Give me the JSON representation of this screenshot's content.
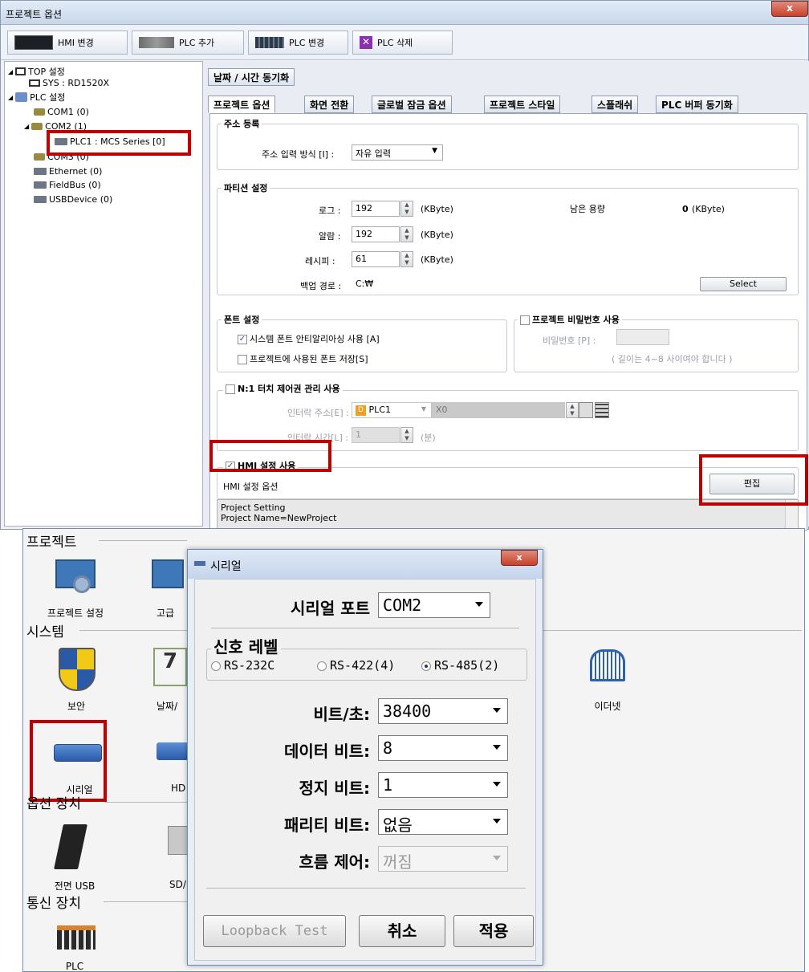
{
  "window": {
    "title": "프로젝트 옵션",
    "close": "x"
  },
  "toolbar": {
    "hmi_change": "HMI 변경",
    "plc_add": "PLC 추가",
    "plc_change": "PLC 변경",
    "plc_delete": "PLC 삭제"
  },
  "tree": {
    "top": "TOP 설정",
    "sys": "SYS : RD1520X",
    "plc": "PLC 설정",
    "com1": "COM1 (0)",
    "com2": "COM2 (1)",
    "plc1": "PLC1 : MCS Series [0]",
    "com3": "COM3 (0)",
    "ethernet": "Ethernet (0)",
    "fieldbus": "FieldBus (0)",
    "usb": "USBDevice (0)"
  },
  "tabs": {
    "row1": [
      "날짜 / 시간 동기화"
    ],
    "row2": [
      "프로젝트 옵션",
      "화면 전환",
      "글로벌 잠금 옵션",
      "프로젝트 스타일",
      "스플래쉬",
      "PLC 버퍼 동기화"
    ]
  },
  "address": {
    "legend": "주소 등록",
    "label": "주소 입력 방식 [I] :",
    "value": "자유 입력"
  },
  "partition": {
    "legend": "파티션 설정",
    "log_label": "로그 :",
    "log_value": "192",
    "alarm_label": "알람 :",
    "alarm_value": "192",
    "recipe_label": "레시피 :",
    "recipe_value": "61",
    "unit": "(KByte)",
    "remain_label": "남은 용량",
    "remain_value": "0",
    "backup_label": "백업 경로 :",
    "backup_value": "C:₩",
    "select": "Select"
  },
  "font": {
    "legend": "폰트 설정",
    "antialias": "시스템 폰트 안티알리아싱 사용 [A]",
    "save": "프로젝트에 사용된 폰트 저장[S]"
  },
  "password": {
    "legend": "프로젝트 비밀번호 사용",
    "label": "비밀번호 [P] :",
    "hint": "( 길이는 4~8 사이여야 합니다 )"
  },
  "touch": {
    "legend": "N:1 터치 제어권 관리 사용",
    "addr_label": "인터락 주소[E] :",
    "addr_plc": "PLC1",
    "addr_value": "X0",
    "time_label": "인터락 시간[L] :",
    "time_value": "1",
    "time_unit": "(분)"
  },
  "hmi": {
    "legend": "HMI 설정 사용",
    "options": "HMI 설정 옵션",
    "edit": "편집",
    "log": [
      "Project Setting",
      "Project Name=NewProject"
    ]
  },
  "panel": {
    "project": "프로젝트",
    "project_setting": "프로젝트 설정",
    "advanced": "고급",
    "system": "시스템",
    "security": "보안",
    "datetime": "날짜/",
    "ethernet": "이더넷",
    "serial": "시리얼",
    "hd": "HD",
    "options": "옵션 장치",
    "front_usb": "전면 USB",
    "sd": "SD/",
    "comm": "통신 장치",
    "plc": "PLC",
    "calendar_day": "7"
  },
  "dialog": {
    "title": "시리얼",
    "close": "x",
    "port_label": "시리얼 포트",
    "port_value": "COM2",
    "signal_legend": "신호 레벨",
    "signal_options": [
      "RS-232C",
      "RS-422(4)",
      "RS-485(2)"
    ],
    "signal_selected": "RS-485(2)",
    "baud_label": "비트/초:",
    "baud_value": "38400",
    "data_label": "데이터 비트:",
    "data_value": "8",
    "stop_label": "정지 비트:",
    "stop_value": "1",
    "parity_label": "패리티 비트:",
    "parity_value": "없음",
    "flow_label": "흐름 제어:",
    "flow_value": "꺼짐",
    "loopback": "Loopback Test",
    "cancel": "취소",
    "apply": "적용"
  },
  "colors": {
    "highlight": "#c00000",
    "accent": "#1f3c66"
  }
}
